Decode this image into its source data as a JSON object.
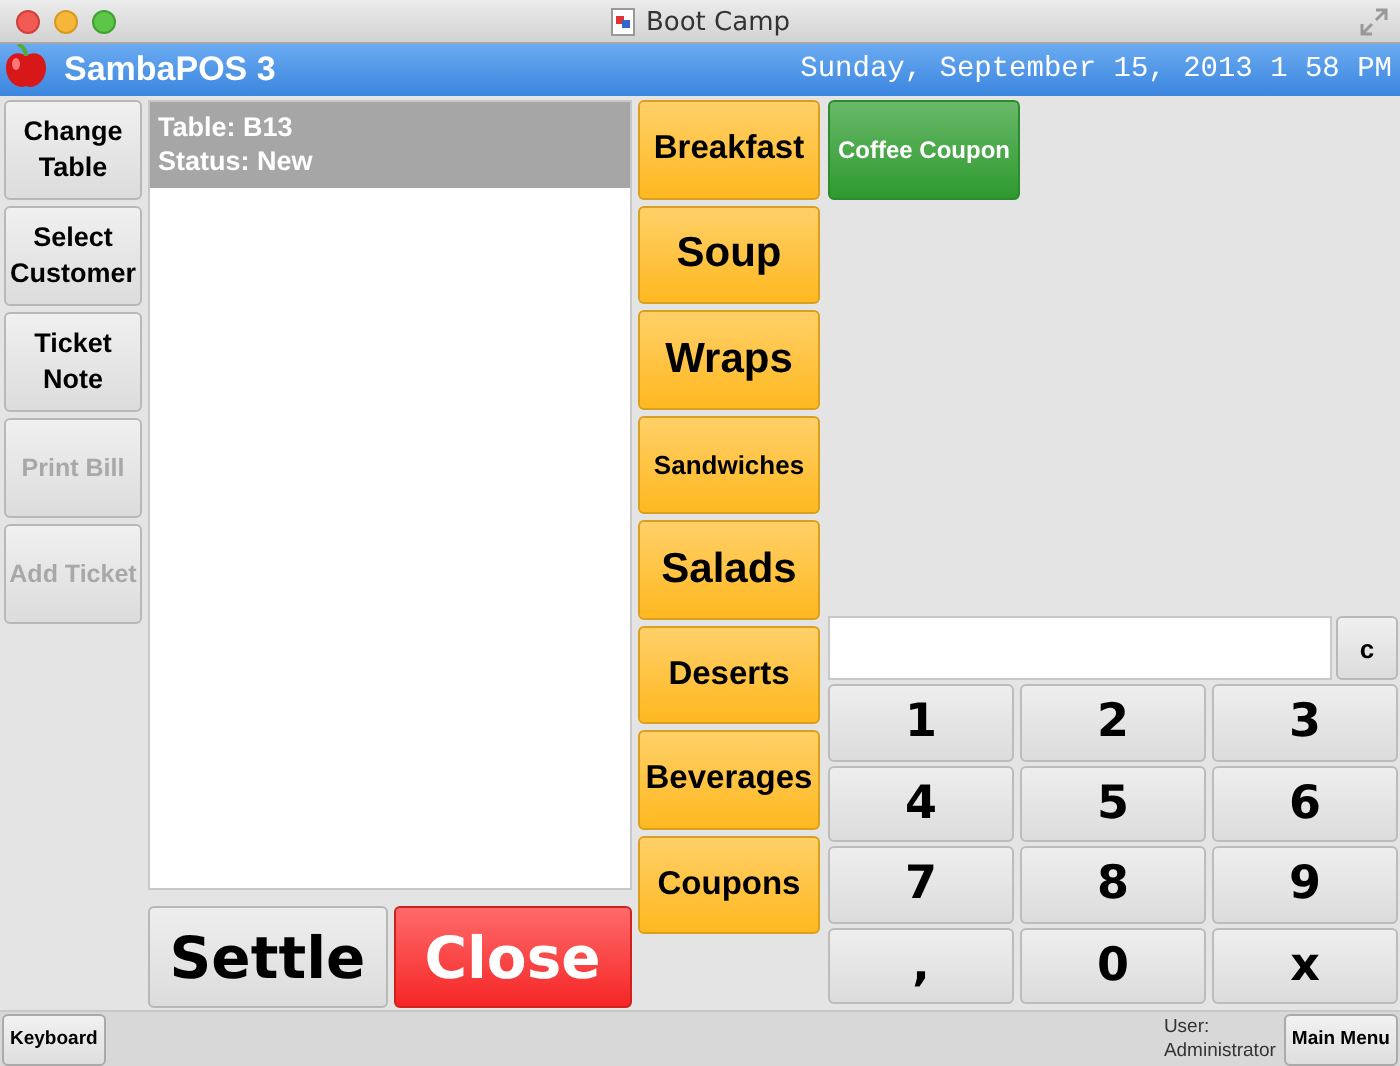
{
  "window": {
    "title": "Boot Camp"
  },
  "header": {
    "app_name": "SambaPOS 3",
    "datetime": "Sunday, September 15, 2013 1 58 PM"
  },
  "ticket_commands": [
    {
      "label": "Change Table",
      "disabled": false
    },
    {
      "label": "Select Customer",
      "disabled": false
    },
    {
      "label": "Ticket Note",
      "disabled": false
    },
    {
      "label": "Print Bill",
      "disabled": true
    },
    {
      "label": "Add Ticket",
      "disabled": true
    }
  ],
  "ticket": {
    "lines": [
      "Table: B13",
      "Status: New"
    ]
  },
  "actions": [
    {
      "label": "Settle",
      "kind": "settle"
    },
    {
      "label": "Close",
      "kind": "close"
    }
  ],
  "categories": [
    "Breakfast",
    "Soup",
    "Wraps",
    "Sandwiches",
    "Salads",
    "Deserts",
    "Beverages",
    "Coupons"
  ],
  "products": [
    "Coffee Coupon"
  ],
  "numpad": {
    "clear": "c",
    "keys": [
      "1",
      "2",
      "3",
      "4",
      "5",
      "6",
      "7",
      "8",
      "9",
      ",",
      "0",
      "x"
    ]
  },
  "footer": {
    "keyboard": "Keyboard",
    "user_label": "User:",
    "user_name": "Administrator",
    "main_menu": "Main Menu"
  }
}
